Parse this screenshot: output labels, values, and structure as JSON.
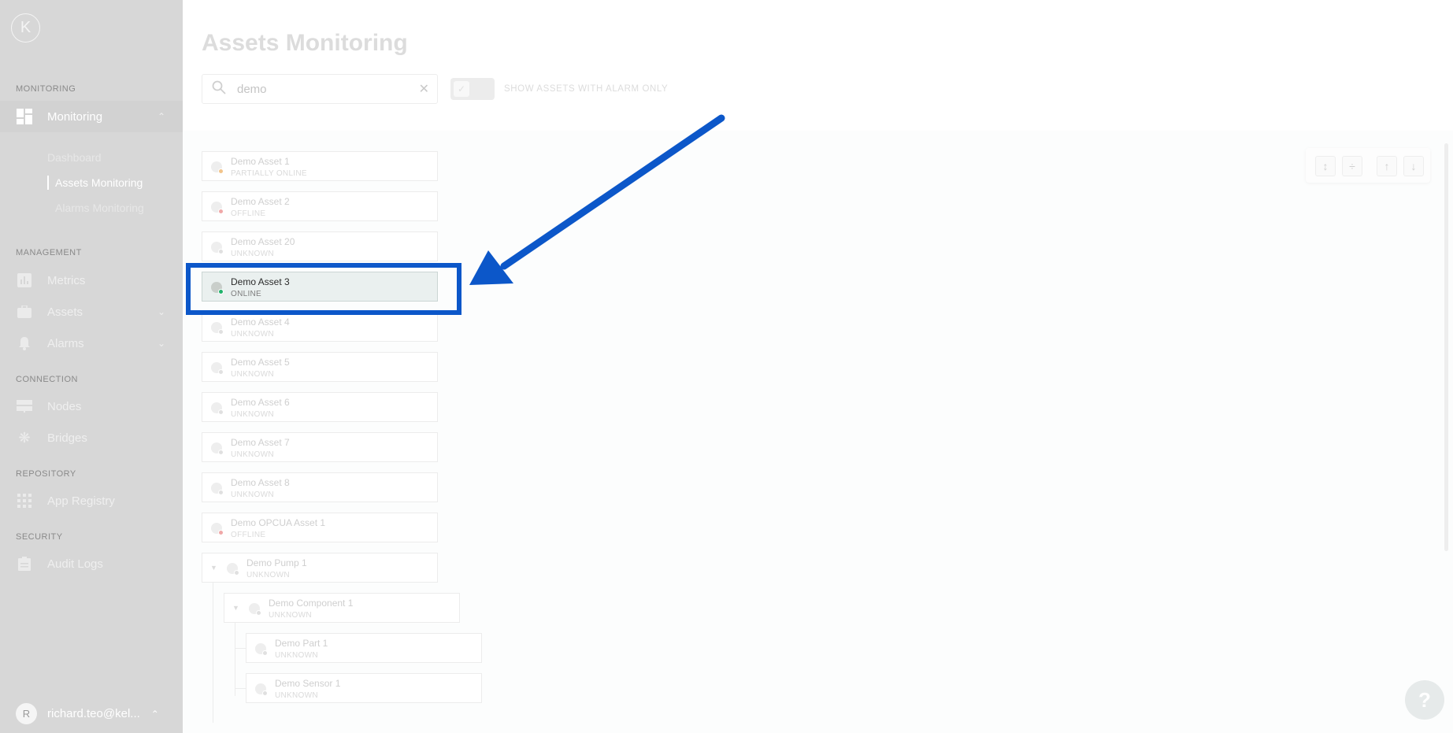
{
  "sidebar": {
    "logo": "K",
    "sections": {
      "monitoring": "MONITORING",
      "management": "MANAGEMENT",
      "connection": "CONNECTION",
      "repository": "REPOSITORY",
      "security": "SECURITY"
    },
    "items": {
      "monitoring": "Monitoring",
      "dashboard": "Dashboard",
      "assets_monitoring": "Assets Monitoring",
      "alarms_monitoring": "Alarms Monitoring",
      "metrics": "Metrics",
      "assets": "Assets",
      "alarms": "Alarms",
      "nodes": "Nodes",
      "bridges": "Bridges",
      "app_registry": "App Registry",
      "audit_logs": "Audit Logs"
    },
    "user": {
      "initial": "R",
      "email": "richard.teo@kel..."
    }
  },
  "main": {
    "title": "Assets Monitoring",
    "search": {
      "value": "demo"
    },
    "alarm_toggle_label": "SHOW ASSETS WITH ALARM ONLY",
    "assets": [
      {
        "name": "Demo Asset 1",
        "status": "PARTIALLY ONLINE",
        "color": "#f2c48a"
      },
      {
        "name": "Demo Asset 2",
        "status": "OFFLINE",
        "color": "#f0a8a8"
      },
      {
        "name": "Demo Asset 20",
        "status": "UNKNOWN",
        "color": "#e0e0e0"
      },
      {
        "name": "Demo Asset 3",
        "status": "ONLINE",
        "color": "#20b26b"
      },
      {
        "name": "Demo Asset 4",
        "status": "UNKNOWN",
        "color": "#e0e0e0"
      },
      {
        "name": "Demo Asset 5",
        "status": "UNKNOWN",
        "color": "#e0e0e0"
      },
      {
        "name": "Demo Asset 6",
        "status": "UNKNOWN",
        "color": "#e0e0e0"
      },
      {
        "name": "Demo Asset 7",
        "status": "UNKNOWN",
        "color": "#e0e0e0"
      },
      {
        "name": "Demo Asset 8",
        "status": "UNKNOWN",
        "color": "#e0e0e0"
      },
      {
        "name": "Demo OPCUA Asset 1",
        "status": "OFFLINE",
        "color": "#f0a8a8"
      },
      {
        "name": "Demo Pump 1",
        "status": "UNKNOWN",
        "color": "#e0e0e0"
      },
      {
        "name": "Demo Component 1",
        "status": "UNKNOWN",
        "color": "#e0e0e0"
      },
      {
        "name": "Demo Part 1",
        "status": "UNKNOWN",
        "color": "#e0e0e0"
      },
      {
        "name": "Demo Sensor 1",
        "status": "UNKNOWN",
        "color": "#e0e0e0"
      }
    ],
    "help": "?"
  },
  "colors": {
    "highlight": "#0c57c9",
    "online": "#20b26b"
  }
}
